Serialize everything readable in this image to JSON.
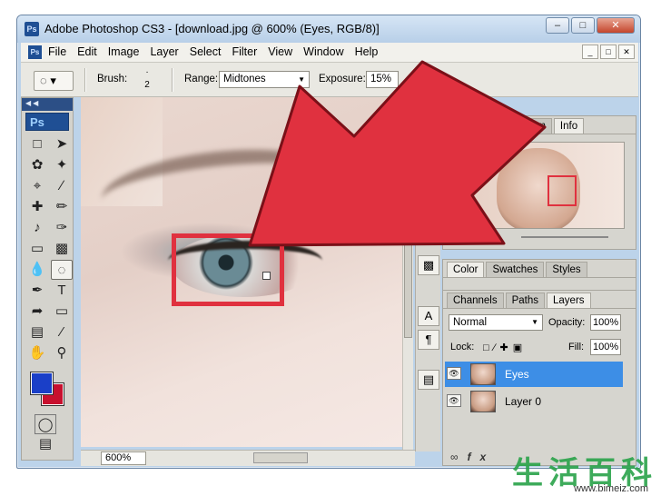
{
  "window": {
    "title": "Adobe Photoshop CS3 - [download.jpg @ 600% (Eyes, RGB/8)]",
    "app_icon": "Ps",
    "controls": [
      "minimize",
      "maximize",
      "close"
    ]
  },
  "menubar": {
    "items": [
      "File",
      "Edit",
      "Image",
      "Layer",
      "Select",
      "Filter",
      "View",
      "Window",
      "Help"
    ]
  },
  "options": {
    "brush_label": "Brush:",
    "brush_size": "2",
    "range_label": "Range:",
    "range_value": "Midtones",
    "exposure_label": "Exposure:",
    "exposure_value": "15%"
  },
  "toolbox": {
    "logo": "Ps",
    "tools": [
      "marquee-icon",
      "move-icon",
      "lasso-icon",
      "magic-wand-icon",
      "crop-icon",
      "slice-icon",
      "healing-icon",
      "brush-icon",
      "stamp-icon",
      "history-brush-icon",
      "eraser-icon",
      "gradient-icon",
      "blur-icon",
      "dodge-icon",
      "pen-icon",
      "type-icon",
      "path-select-icon",
      "shape-icon",
      "notes-icon",
      "eyedropper-icon",
      "hand-icon",
      "zoom-icon"
    ],
    "foreground_color": "#1a3fc8",
    "background_color": "#c8102e"
  },
  "canvas": {
    "zoom": "600%"
  },
  "navigator": {
    "tabs": [
      "Navigator",
      "Histogram",
      "Info"
    ],
    "tab_visible_parts": [
      "N",
      "m",
      "Info"
    ]
  },
  "color_panel": {
    "tabs": [
      "Color",
      "Swatches",
      "Styles"
    ]
  },
  "layers_panel": {
    "tabs": [
      "Channels",
      "Paths",
      "Layers"
    ],
    "blend_mode": "Normal",
    "opacity_label": "Opacity:",
    "opacity": "100%",
    "lock_label": "Lock:",
    "fill_label": "Fill:",
    "fill": "100%",
    "layers": [
      {
        "name": "Eyes",
        "selected": true
      },
      {
        "name": "Layer 0",
        "selected": false
      }
    ]
  },
  "watermark": {
    "text": "生活百科",
    "url": "www.bimeiz.com"
  }
}
